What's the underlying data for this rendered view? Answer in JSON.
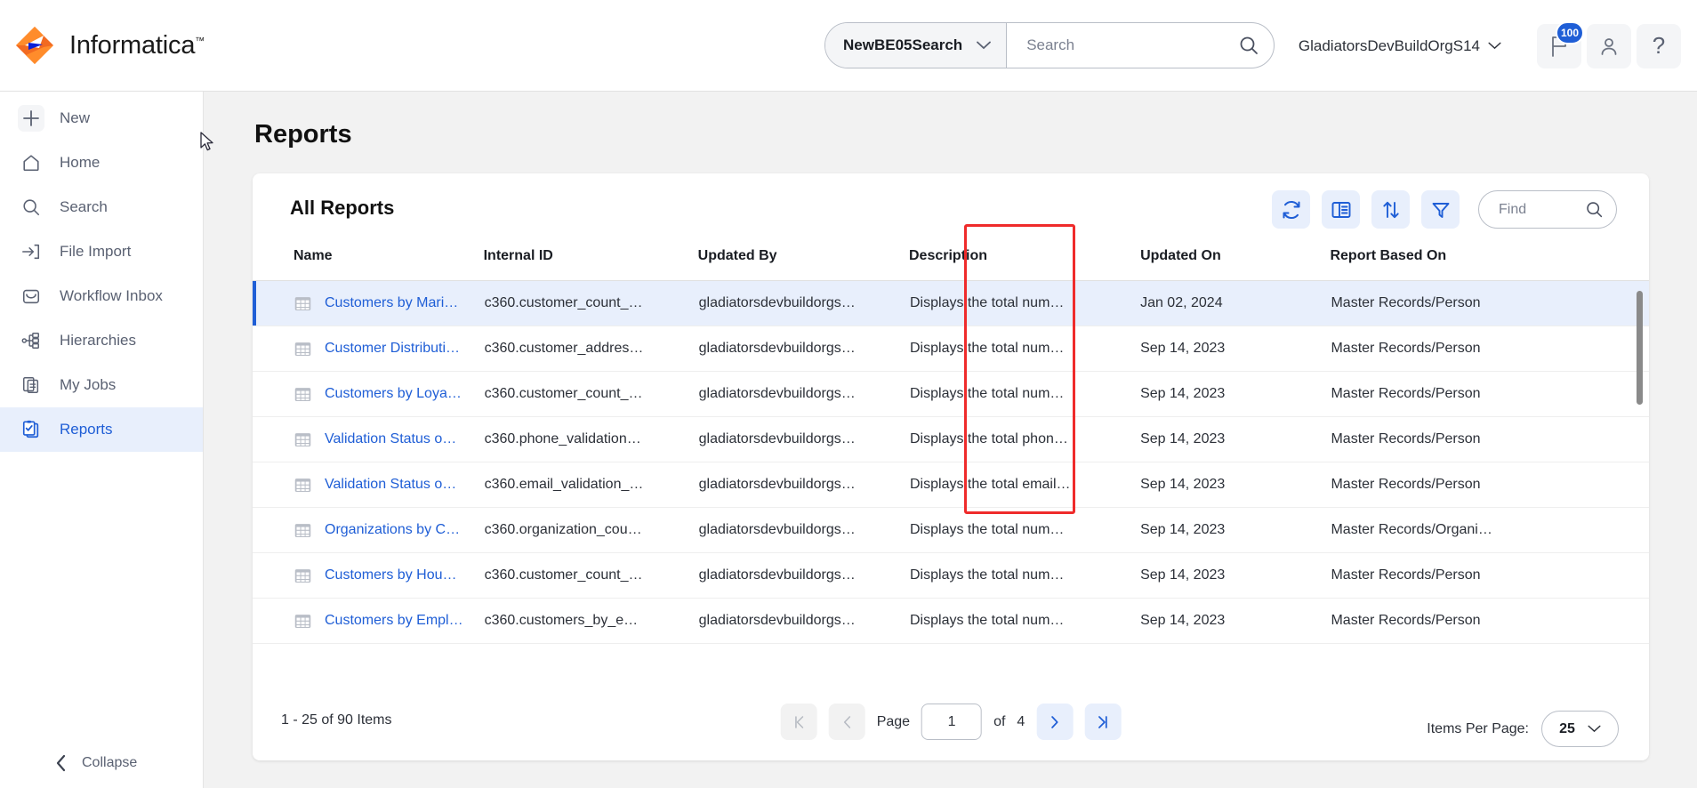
{
  "header": {
    "brand": "Informatica",
    "brand_tm": "™",
    "scope_value": "NewBE05Search",
    "search_placeholder": "Search",
    "org": "GladiatorsDevBuildOrgS14",
    "notifications_badge": "100",
    "help_glyph": "?"
  },
  "sidebar": {
    "items": [
      {
        "label": "New",
        "icon": "plus-icon",
        "active": false
      },
      {
        "label": "Home",
        "icon": "home-icon",
        "active": false
      },
      {
        "label": "Search",
        "icon": "search-icon",
        "active": false
      },
      {
        "label": "File Import",
        "icon": "file-import-icon",
        "active": false
      },
      {
        "label": "Workflow Inbox",
        "icon": "inbox-icon",
        "active": false
      },
      {
        "label": "Hierarchies",
        "icon": "hierarchy-icon",
        "active": false
      },
      {
        "label": "My Jobs",
        "icon": "my-jobs-icon",
        "active": false
      },
      {
        "label": "Reports",
        "icon": "reports-icon",
        "active": true
      }
    ],
    "collapse_label": "Collapse"
  },
  "page": {
    "title": "Reports",
    "card_title": "All Reports",
    "find_placeholder": "Find",
    "toolbar": [
      {
        "name": "refresh-icon"
      },
      {
        "name": "columns-icon"
      },
      {
        "name": "sort-icon"
      },
      {
        "name": "filter-icon"
      }
    ]
  },
  "table": {
    "columns": [
      "Name",
      "Internal ID",
      "Updated By",
      "Description",
      "Updated On",
      "Report Based On"
    ],
    "rows": [
      {
        "name": "Customers by Mari…",
        "internal_id": "c360.customer_count_…",
        "updated_by": "gladiatorsdevbuildorgs…",
        "description": "Displays the total num…",
        "updated_on": "Jan 02, 2024",
        "based_on": "Master Records/Person",
        "selected": true
      },
      {
        "name": "Customer Distributi…",
        "internal_id": "c360.customer_addres…",
        "updated_by": "gladiatorsdevbuildorgs…",
        "description": "Displays the total num…",
        "updated_on": "Sep 14, 2023",
        "based_on": "Master Records/Person",
        "selected": false
      },
      {
        "name": "Customers by Loya…",
        "internal_id": "c360.customer_count_…",
        "updated_by": "gladiatorsdevbuildorgs…",
        "description": "Displays the total num…",
        "updated_on": "Sep 14, 2023",
        "based_on": "Master Records/Person",
        "selected": false
      },
      {
        "name": "Validation Status o…",
        "internal_id": "c360.phone_validation…",
        "updated_by": "gladiatorsdevbuildorgs…",
        "description": "Displays the total phon…",
        "updated_on": "Sep 14, 2023",
        "based_on": "Master Records/Person",
        "selected": false
      },
      {
        "name": "Validation Status o…",
        "internal_id": "c360.email_validation_…",
        "updated_by": "gladiatorsdevbuildorgs…",
        "description": "Displays the total email…",
        "updated_on": "Sep 14, 2023",
        "based_on": "Master Records/Person",
        "selected": false
      },
      {
        "name": "Organizations by C…",
        "internal_id": "c360.organization_cou…",
        "updated_by": "gladiatorsdevbuildorgs…",
        "description": "Displays the total num…",
        "updated_on": "Sep 14, 2023",
        "based_on": "Master Records/Organi…",
        "selected": false
      },
      {
        "name": "Customers by Hou…",
        "internal_id": "c360.customer_count_…",
        "updated_by": "gladiatorsdevbuildorgs…",
        "description": "Displays the total num…",
        "updated_on": "Sep 14, 2023",
        "based_on": "Master Records/Person",
        "selected": false
      },
      {
        "name": "Customers by Empl…",
        "internal_id": "c360.customers_by_e…",
        "updated_by": "gladiatorsdevbuildorgs…",
        "description": "Displays the total num…",
        "updated_on": "Sep 14, 2023",
        "based_on": "Master Records/Person",
        "selected": false
      }
    ]
  },
  "footer": {
    "count_text": "1 - 25 of 90 Items",
    "page_label": "Page",
    "page_value": "1",
    "of_label": "of",
    "total_pages": "4",
    "items_per_page_label": "Items Per Page:",
    "items_per_page_value": "25"
  },
  "annotation": {
    "highlight_color": "#ef2b2b",
    "highlight_target": "Updated On"
  }
}
